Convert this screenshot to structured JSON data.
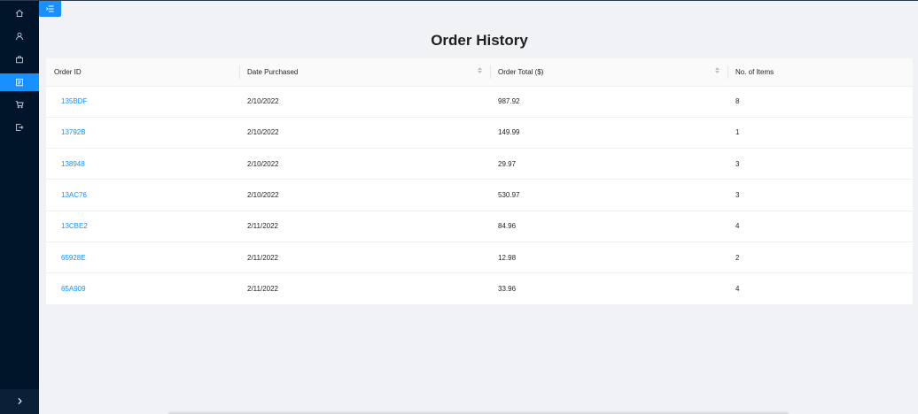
{
  "sidebar": {
    "items": [
      {
        "icon": "home-icon"
      },
      {
        "icon": "user-icon"
      },
      {
        "icon": "shopping-bag-icon"
      },
      {
        "icon": "orders-icon",
        "active": true
      },
      {
        "icon": "cart-icon"
      },
      {
        "icon": "logout-icon"
      }
    ],
    "collapse_icon": "chevron-right-icon"
  },
  "header": {
    "menu_toggle_icon": "menu-fold-icon"
  },
  "page": {
    "title": "Order History"
  },
  "table": {
    "columns": [
      {
        "label": "Order ID",
        "sortable": false
      },
      {
        "label": "Date Purchased",
        "sortable": true
      },
      {
        "label": "Order Total ($)",
        "sortable": true
      },
      {
        "label": "No. of Items",
        "sortable": false
      }
    ],
    "rows": [
      {
        "order_id": "135BDF",
        "date": "2/10/2022",
        "total": "987.92",
        "items": "8"
      },
      {
        "order_id": "13792B",
        "date": "2/10/2022",
        "total": "149.99",
        "items": "1"
      },
      {
        "order_id": "138948",
        "date": "2/10/2022",
        "total": "29.97",
        "items": "3"
      },
      {
        "order_id": "13AC76",
        "date": "2/10/2022",
        "total": "530.97",
        "items": "3"
      },
      {
        "order_id": "13CBE2",
        "date": "2/11/2022",
        "total": "84.96",
        "items": "4"
      },
      {
        "order_id": "65928E",
        "date": "2/11/2022",
        "total": "12.98",
        "items": "2"
      },
      {
        "order_id": "65A909",
        "date": "2/11/2022",
        "total": "33.96",
        "items": "4"
      }
    ]
  },
  "colors": {
    "sidebar_bg": "#001529",
    "accent": "#1890ff",
    "page_bg": "#f0f2f5"
  }
}
